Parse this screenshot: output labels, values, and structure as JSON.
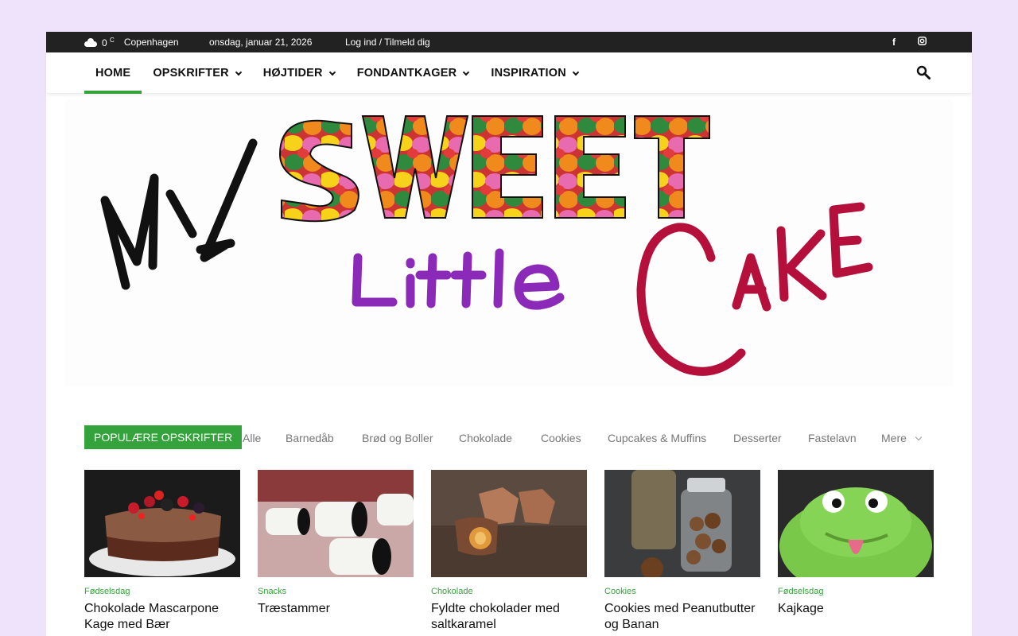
{
  "topbar": {
    "weather_temp": "0",
    "weather_unit": "C",
    "city": "Copenhagen",
    "date": "onsdag, januar 21, 2026",
    "login": "Log ind / Tilmeld dig",
    "social_facebook": "f",
    "social_instagram": "instagram-icon"
  },
  "nav": {
    "items": [
      {
        "label": "HOME"
      },
      {
        "label": "OPSKRIFTER"
      },
      {
        "label": "HØJTIDER"
      },
      {
        "label": "FONDANTKAGER"
      },
      {
        "label": "INSPIRATION"
      }
    ]
  },
  "logo": {
    "line1": "MY",
    "line2": "SWEET",
    "line3": "Little",
    "line4": "CAKE"
  },
  "popular": {
    "label": "POPULÆRE OPSKRIFTER",
    "categories": [
      "Alle",
      "Barnedåb",
      "Brød og Boller",
      "Chokolade",
      "Cookies",
      "Cupcakes & Muffins",
      "Desserter",
      "Fastelavn",
      "Mere"
    ]
  },
  "cards": [
    {
      "tag": "Fødselsdag",
      "title": "Chokolade Mascarpone Kage med Bær"
    },
    {
      "tag": "Snacks",
      "title": "Træstammer"
    },
    {
      "tag": "Chokolade",
      "title": "Fyldte chokolader med saltkaramel"
    },
    {
      "tag": "Cookies",
      "title": "Cookies med Peanutbutter og Banan"
    },
    {
      "tag": "Fødselsdag",
      "title": "Kajkage"
    }
  ],
  "colors": {
    "accent": "#35a33b",
    "topbar": "#222222",
    "page_bg": "#efe3fc",
    "logo_purple": "#8b2ab8",
    "logo_red": "#b5103c"
  }
}
